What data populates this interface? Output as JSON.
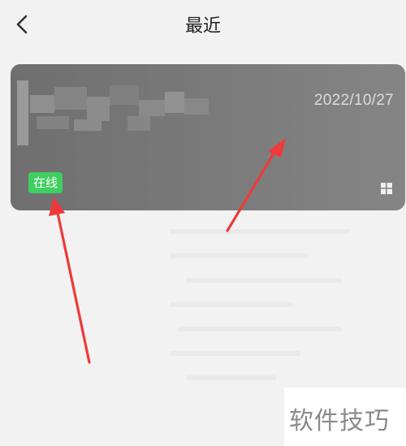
{
  "header": {
    "back_icon": "chevron-left-icon",
    "title": "最近"
  },
  "device": {
    "date": "2022/10/27",
    "status": "在线",
    "status_color": "#3fcf60",
    "os_icon": "windows-icon"
  },
  "watermark": {
    "text": "软件技巧"
  },
  "annotation": {
    "arrow_color": "#ee3a3a"
  }
}
